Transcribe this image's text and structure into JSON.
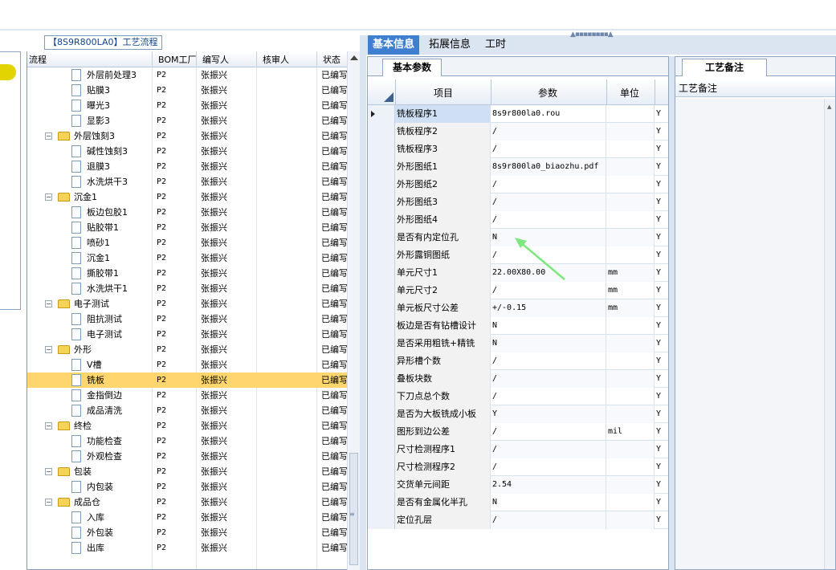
{
  "process_panel": {
    "title": "【8S9R800LA0】工艺流程",
    "columns": [
      "流程",
      "BOM工厂",
      "编写人",
      "核审人",
      "状态"
    ],
    "rows": [
      {
        "name": "外层前处理3",
        "level": 2,
        "type": "doc",
        "bom": "P2",
        "writer": "张振兴",
        "status": "已编写"
      },
      {
        "name": "贴膜3",
        "level": 2,
        "type": "doc",
        "bom": "P2",
        "writer": "张振兴",
        "status": "已编写"
      },
      {
        "name": "曝光3",
        "level": 2,
        "type": "doc",
        "bom": "P2",
        "writer": "张振兴",
        "status": "已编写"
      },
      {
        "name": "显影3",
        "level": 2,
        "type": "doc",
        "bom": "P2",
        "writer": "张振兴",
        "status": "已编写"
      },
      {
        "name": "外层蚀刻3",
        "level": 1,
        "type": "folder",
        "bom": "P2",
        "writer": "张振兴",
        "status": "已编写"
      },
      {
        "name": "碱性蚀刻3",
        "level": 2,
        "type": "doc",
        "bom": "P2",
        "writer": "张振兴",
        "status": "已编写"
      },
      {
        "name": "退膜3",
        "level": 2,
        "type": "doc",
        "bom": "P2",
        "writer": "张振兴",
        "status": "已编写"
      },
      {
        "name": "水洗烘干3",
        "level": 2,
        "type": "doc",
        "bom": "P2",
        "writer": "张振兴",
        "status": "已编写"
      },
      {
        "name": "沉金1",
        "level": 1,
        "type": "folder",
        "bom": "P2",
        "writer": "张振兴",
        "status": "已编写"
      },
      {
        "name": "板边包胶1",
        "level": 2,
        "type": "doc",
        "bom": "P2",
        "writer": "张振兴",
        "status": "已编写"
      },
      {
        "name": "贴胶带1",
        "level": 2,
        "type": "doc",
        "bom": "P2",
        "writer": "张振兴",
        "status": "已编写"
      },
      {
        "name": "喷砂1",
        "level": 2,
        "type": "doc",
        "bom": "P2",
        "writer": "张振兴",
        "status": "已编写"
      },
      {
        "name": "沉金1",
        "level": 2,
        "type": "doc",
        "bom": "P2",
        "writer": "张振兴",
        "status": "已编写"
      },
      {
        "name": "撕胶带1",
        "level": 2,
        "type": "doc",
        "bom": "P2",
        "writer": "张振兴",
        "status": "已编写"
      },
      {
        "name": "水洗烘干1",
        "level": 2,
        "type": "doc",
        "bom": "P2",
        "writer": "张振兴",
        "status": "已编写"
      },
      {
        "name": "电子测试",
        "level": 1,
        "type": "folder",
        "bom": "P2",
        "writer": "张振兴",
        "status": "已编写"
      },
      {
        "name": "阻抗测试",
        "level": 2,
        "type": "doc",
        "bom": "P2",
        "writer": "张振兴",
        "status": "已编写"
      },
      {
        "name": "电子测试",
        "level": 2,
        "type": "doc",
        "bom": "P2",
        "writer": "张振兴",
        "status": "已编写"
      },
      {
        "name": "外形",
        "level": 1,
        "type": "folder",
        "bom": "P2",
        "writer": "张振兴",
        "status": "已编写"
      },
      {
        "name": "V槽",
        "level": 2,
        "type": "doc",
        "bom": "P2",
        "writer": "张振兴",
        "status": "已编写"
      },
      {
        "name": "铣板",
        "level": 2,
        "type": "doc",
        "bom": "P2",
        "writer": "张振兴",
        "status": "已编写",
        "selected": true
      },
      {
        "name": "金指倒边",
        "level": 2,
        "type": "doc",
        "bom": "P2",
        "writer": "张振兴",
        "status": "已编写"
      },
      {
        "name": "成品清洗",
        "level": 2,
        "type": "doc",
        "bom": "P2",
        "writer": "张振兴",
        "status": "已编写"
      },
      {
        "name": "终检",
        "level": 1,
        "type": "folder",
        "bom": "P2",
        "writer": "张振兴",
        "status": "已编写"
      },
      {
        "name": "功能检查",
        "level": 2,
        "type": "doc",
        "bom": "P2",
        "writer": "张振兴",
        "status": "已编写"
      },
      {
        "name": "外观检查",
        "level": 2,
        "type": "doc",
        "bom": "P2",
        "writer": "张振兴",
        "status": "已编写"
      },
      {
        "name": "包装",
        "level": 1,
        "type": "folder",
        "bom": "P2",
        "writer": "张振兴",
        "status": "已编写"
      },
      {
        "name": "内包装",
        "level": 2,
        "type": "doc",
        "bom": "P2",
        "writer": "张振兴",
        "status": "已编写"
      },
      {
        "name": "成品仓",
        "level": 1,
        "type": "folder",
        "bom": "P2",
        "writer": "张振兴",
        "status": "已编写"
      },
      {
        "name": "入库",
        "level": 2,
        "type": "doc",
        "bom": "P2",
        "writer": "张振兴",
        "status": "已编写"
      },
      {
        "name": "外包装",
        "level": 2,
        "type": "doc",
        "bom": "P2",
        "writer": "张振兴",
        "status": "已编写"
      },
      {
        "name": "出库",
        "level": 2,
        "type": "doc",
        "bom": "P2",
        "writer": "张振兴",
        "status": "已编写"
      }
    ]
  },
  "tabs": [
    "基本信息",
    "拓展信息",
    "工时"
  ],
  "active_tab": "基本信息",
  "basic_params": {
    "subtab": "基本参数",
    "columns": {
      "item": "项目",
      "param": "参数",
      "unit": "单位"
    },
    "rows": [
      {
        "item": "铣板程序1",
        "param": "8s9r800la0.rou",
        "unit": "",
        "flag": "Y",
        "selected": true
      },
      {
        "item": "铣板程序2",
        "param": "/",
        "unit": "",
        "flag": "Y"
      },
      {
        "item": "铣板程序3",
        "param": "/",
        "unit": "",
        "flag": "Y"
      },
      {
        "item": "外形图纸1",
        "param": "8s9r800la0_biaozhu.pdf",
        "unit": "",
        "flag": "Y"
      },
      {
        "item": "外形图纸2",
        "param": "/",
        "unit": "",
        "flag": "Y"
      },
      {
        "item": "外形图纸3",
        "param": "/",
        "unit": "",
        "flag": "Y"
      },
      {
        "item": "外形图纸4",
        "param": "/",
        "unit": "",
        "flag": "Y"
      },
      {
        "item": "是否有内定位孔",
        "param": "N",
        "unit": "",
        "flag": "Y"
      },
      {
        "item": "外形露铜图纸",
        "param": "/",
        "unit": "",
        "flag": "Y"
      },
      {
        "item": "单元尺寸1",
        "param": "22.00X80.00",
        "unit": "mm",
        "flag": "Y"
      },
      {
        "item": "单元尺寸2",
        "param": "/",
        "unit": "mm",
        "flag": "Y"
      },
      {
        "item": "单元板尺寸公差",
        "param": "+/-0.15",
        "unit": "mm",
        "flag": "Y"
      },
      {
        "item": "板边是否有钻槽设计",
        "param": "N",
        "unit": "",
        "flag": "Y"
      },
      {
        "item": "是否采用粗铣+精铣",
        "param": "N",
        "unit": "",
        "flag": "Y"
      },
      {
        "item": "异形槽个数",
        "param": "/",
        "unit": "",
        "flag": "Y"
      },
      {
        "item": "叠板块数",
        "param": "/",
        "unit": "",
        "flag": "Y"
      },
      {
        "item": "下刀点总个数",
        "param": "/",
        "unit": "",
        "flag": "Y"
      },
      {
        "item": "是否为大板铣成小板",
        "param": "Y",
        "unit": "",
        "flag": "Y"
      },
      {
        "item": "图形到边公差",
        "param": "/",
        "unit": "mil",
        "flag": "Y"
      },
      {
        "item": "尺寸检测程序1",
        "param": "/",
        "unit": "",
        "flag": "Y"
      },
      {
        "item": "尺寸检测程序2",
        "param": "/",
        "unit": "",
        "flag": "Y"
      },
      {
        "item": "交货单元间距",
        "param": "2.54",
        "unit": "",
        "flag": "Y"
      },
      {
        "item": "是否有金属化半孔",
        "param": "N",
        "unit": "",
        "flag": "Y"
      },
      {
        "item": "定位孔层",
        "param": "/",
        "unit": "",
        "flag": "Y"
      }
    ]
  },
  "annotation_panel": {
    "tab": "工艺备注",
    "header": "工艺备注"
  },
  "colors": {
    "tab_active": "#3f7fd0",
    "selected_row": "#ffd66e",
    "arrow": "#7de87d"
  },
  "icons": [
    "folder-icon",
    "document-icon",
    "collapse-icon",
    "row-pointer-icon",
    "scroll-up-icon",
    "annotation-arrow-icon"
  ]
}
